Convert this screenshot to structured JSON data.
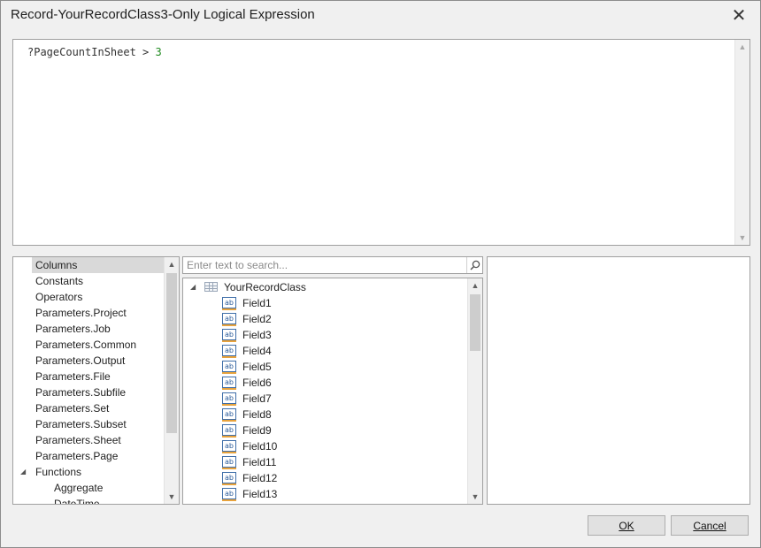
{
  "window": {
    "title": "Record-YourRecordClass3-Only Logical Expression",
    "close_glyph": "✕"
  },
  "editor": {
    "expression_prefix": "?PageCountInSheet > ",
    "expression_number": "3"
  },
  "categories": {
    "items": [
      "Columns",
      "Constants",
      "Operators",
      "Parameters.Project",
      "Parameters.Job",
      "Parameters.Common",
      "Parameters.Output",
      "Parameters.File",
      "Parameters.Subfile",
      "Parameters.Set",
      "Parameters.Subset",
      "Parameters.Sheet",
      "Parameters.Page"
    ],
    "selected": "Columns",
    "functions_label": "Functions",
    "function_children": [
      "Aggregate",
      "DateTime"
    ]
  },
  "search": {
    "placeholder": "Enter text to search...",
    "icon": "magnifier-icon"
  },
  "tree": {
    "root_label": "YourRecordClass",
    "root_icon": "table-icon",
    "field_icon_text": "ab",
    "fields": [
      "Field1",
      "Field2",
      "Field3",
      "Field4",
      "Field5",
      "Field6",
      "Field7",
      "Field8",
      "Field9",
      "Field10",
      "Field11",
      "Field12",
      "Field13"
    ]
  },
  "buttons": {
    "ok_label": "OK",
    "cancel_label": "Cancel"
  },
  "colors": {
    "selection": "#d9d9d9",
    "number_literal": "#1f8a1f",
    "field_icon_border": "#3f6ea8",
    "field_icon_underline": "#e8a33d"
  }
}
